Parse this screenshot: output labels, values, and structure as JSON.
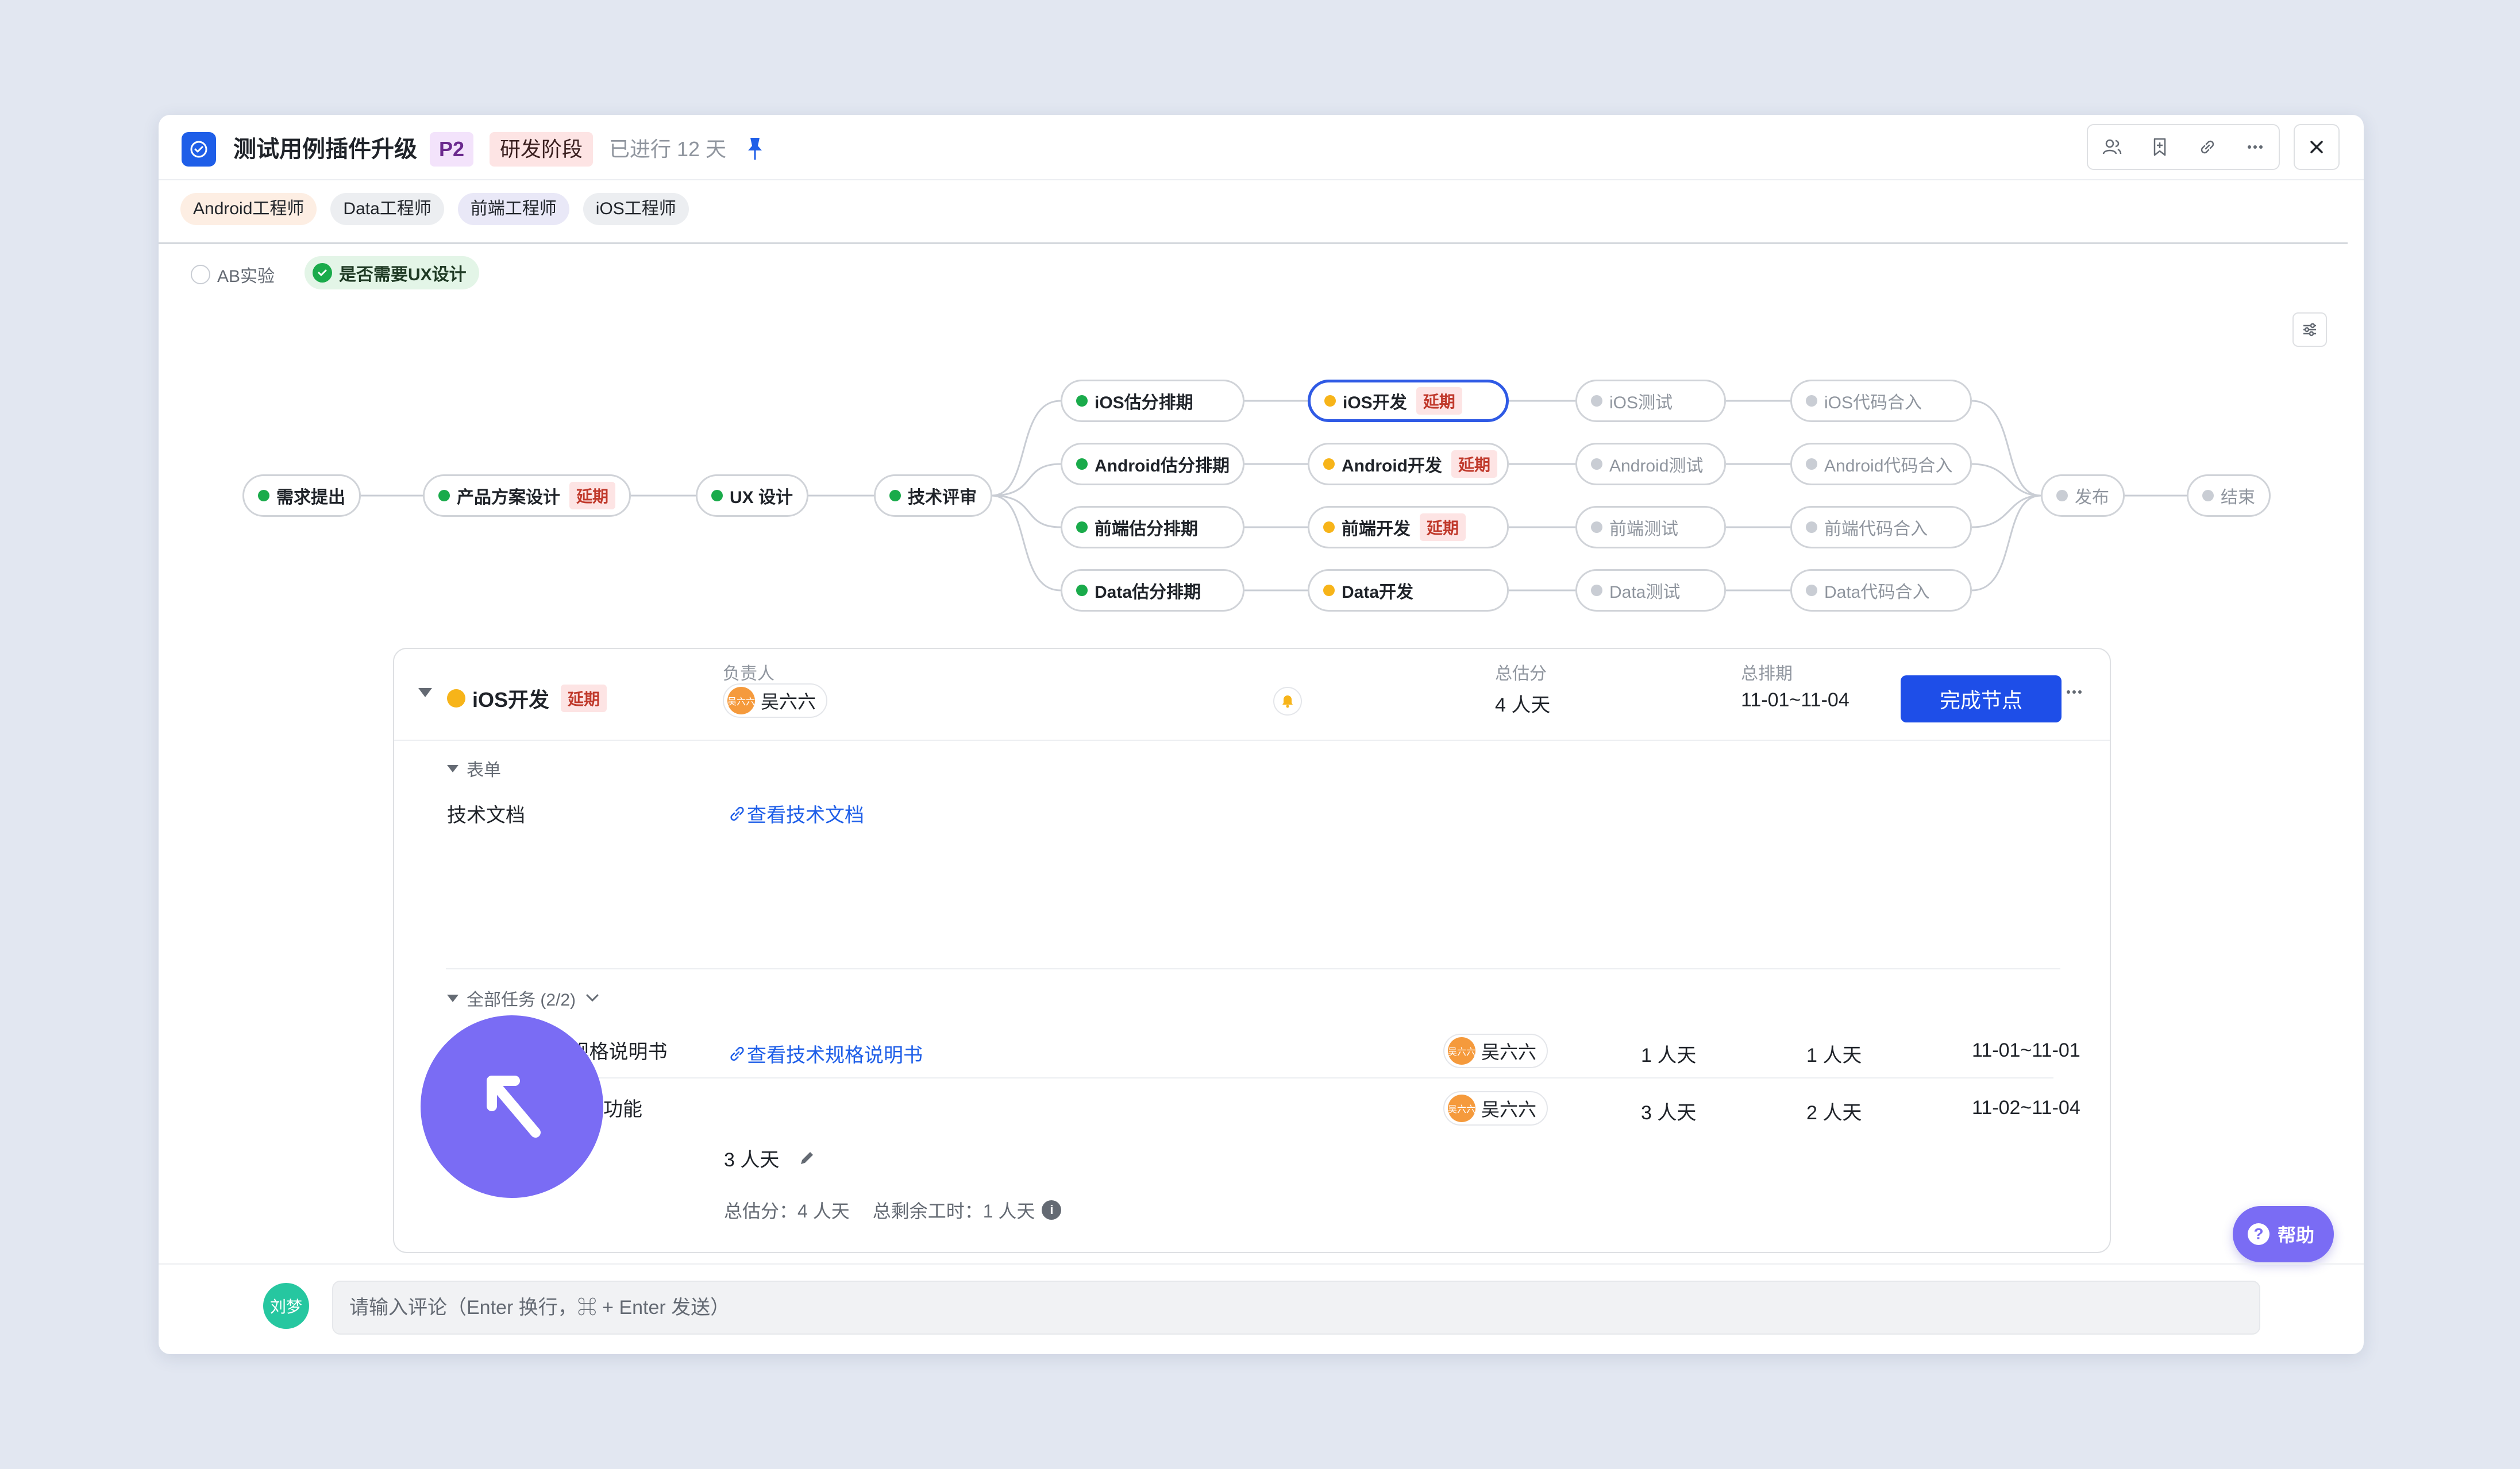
{
  "header": {
    "title": "测试用例插件升级",
    "priority": "P2",
    "stage": "研发阶段",
    "elapsed": "已进行 12 天"
  },
  "roles": [
    "Android工程师",
    "Data工程师",
    "前端工程师",
    "iOS工程师"
  ],
  "options": {
    "ab_test": "AB实验",
    "ux_design": "是否需要UX设计"
  },
  "flow": {
    "start": "需求提出",
    "product": "产品方案设计",
    "ux": "UX 设计",
    "review": "技术评审",
    "late_label": "延期",
    "estimate": [
      "iOS估分排期",
      "Android估分排期",
      "前端估分排期",
      "Data估分排期"
    ],
    "develop": [
      "iOS开发",
      "Android开发",
      "前端开发",
      "Data开发"
    ],
    "test": [
      "iOS测试",
      "Android测试",
      "前端测试",
      "Data测试"
    ],
    "merge": [
      "iOS代码合入",
      "Android代码合入",
      "前端代码合入",
      "Data代码合入"
    ],
    "release": "发布",
    "end": "结束"
  },
  "detail": {
    "node_name": "iOS开发",
    "late_label": "延期",
    "owner_label": "负责人",
    "owner": "吴六六",
    "avatar_text": "吴六六",
    "estimate_label": "总估分",
    "estimate_value": "4 人天",
    "schedule_label": "总排期",
    "schedule_value": "11-01~11-04",
    "complete_button": "完成节点",
    "form_section": "表单",
    "form_field": "技术文档",
    "form_link": "查看技术文档",
    "tasks_section": "全部任务 (2/2)",
    "tasks": [
      {
        "name": "填写 技术规格说明书",
        "link": "查看技术规格说明书",
        "owner": "吴六六",
        "est": "1 人天",
        "rem": "1 人天",
        "date": "11-01~11-01"
      },
      {
        "name": "实现实时更新功能",
        "link": "",
        "owner": "吴六六",
        "est": "3 人天",
        "rem": "2 人天",
        "date": "11-02~11-04"
      }
    ],
    "summary_value": "3 人天",
    "summary_total": "总估分：4 人天",
    "summary_remaining": "总剩余工时：1 人天"
  },
  "help_label": "帮助",
  "comment": {
    "user": "刘梦",
    "placeholder": "请输入评论（Enter 换行，⌘ + Enter 发送）"
  }
}
